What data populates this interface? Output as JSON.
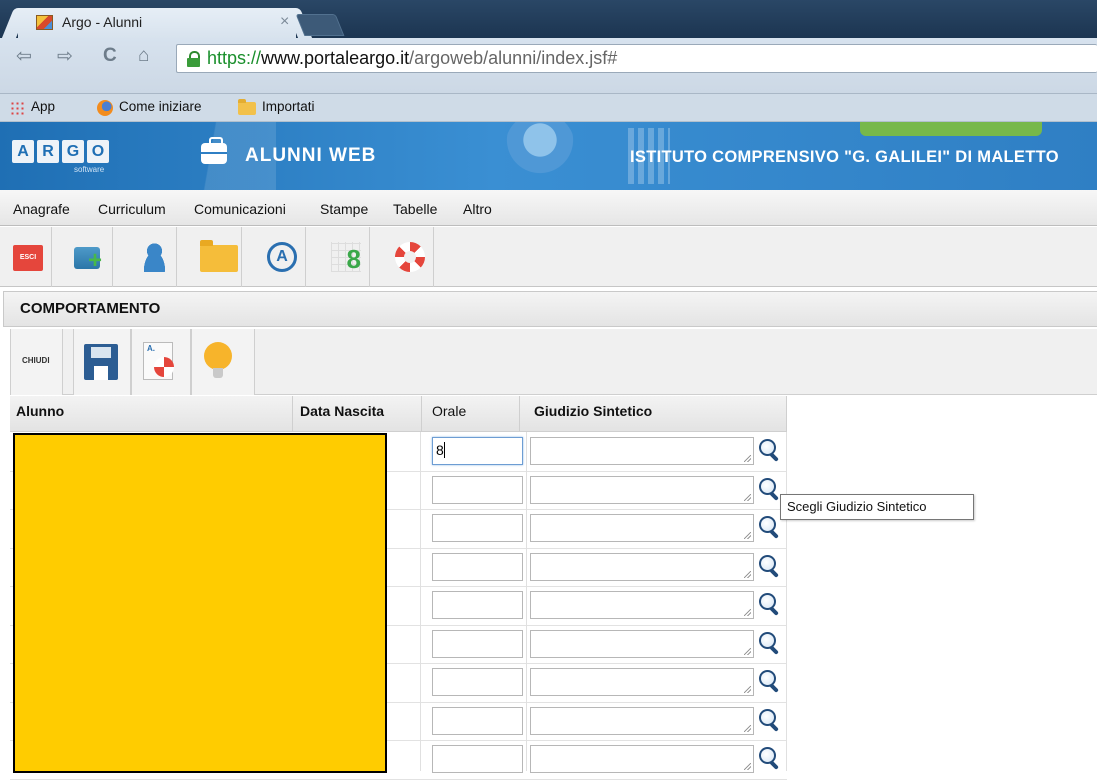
{
  "browser": {
    "tab_title": "Argo - Alunni",
    "tab_close": "×",
    "url_scheme": "https://",
    "url_host": "www.portaleargo.it",
    "url_path": "/argoweb/alunni/index.jsf#",
    "nav": {
      "back": "⇦",
      "forward": "⇨",
      "reload": "C",
      "home": "⌂"
    },
    "bookmarks": [
      "App",
      "Come iniziare",
      "Importati"
    ]
  },
  "app": {
    "logo_letters": [
      "A",
      "R",
      "G",
      "O"
    ],
    "logo_sub": "software",
    "title": "ALUNNI WEB",
    "school": "ISTITUTO COMPRENSIVO \"G. GALILEI\" DI MALETTO"
  },
  "menu": [
    "Anagrafe",
    "Curriculum",
    "Comunicazioni",
    "Stampe",
    "Tabelle",
    "Altro"
  ],
  "toolbar": {
    "esci_label": "ESCI",
    "grid_number": "8",
    "a_label": "A"
  },
  "panel": {
    "title": "COMPORTAMENTO",
    "chiudi_label": "CHIUDI",
    "print_label": "A."
  },
  "table": {
    "headers": [
      "Alunno",
      "Data Nascita",
      "Orale",
      "Giudizio Sintetico"
    ],
    "orale_values": [
      "8",
      "",
      "",
      "",
      "",
      "",
      "",
      "",
      ""
    ]
  },
  "tooltip": "Scegli Giudizio Sintetico"
}
